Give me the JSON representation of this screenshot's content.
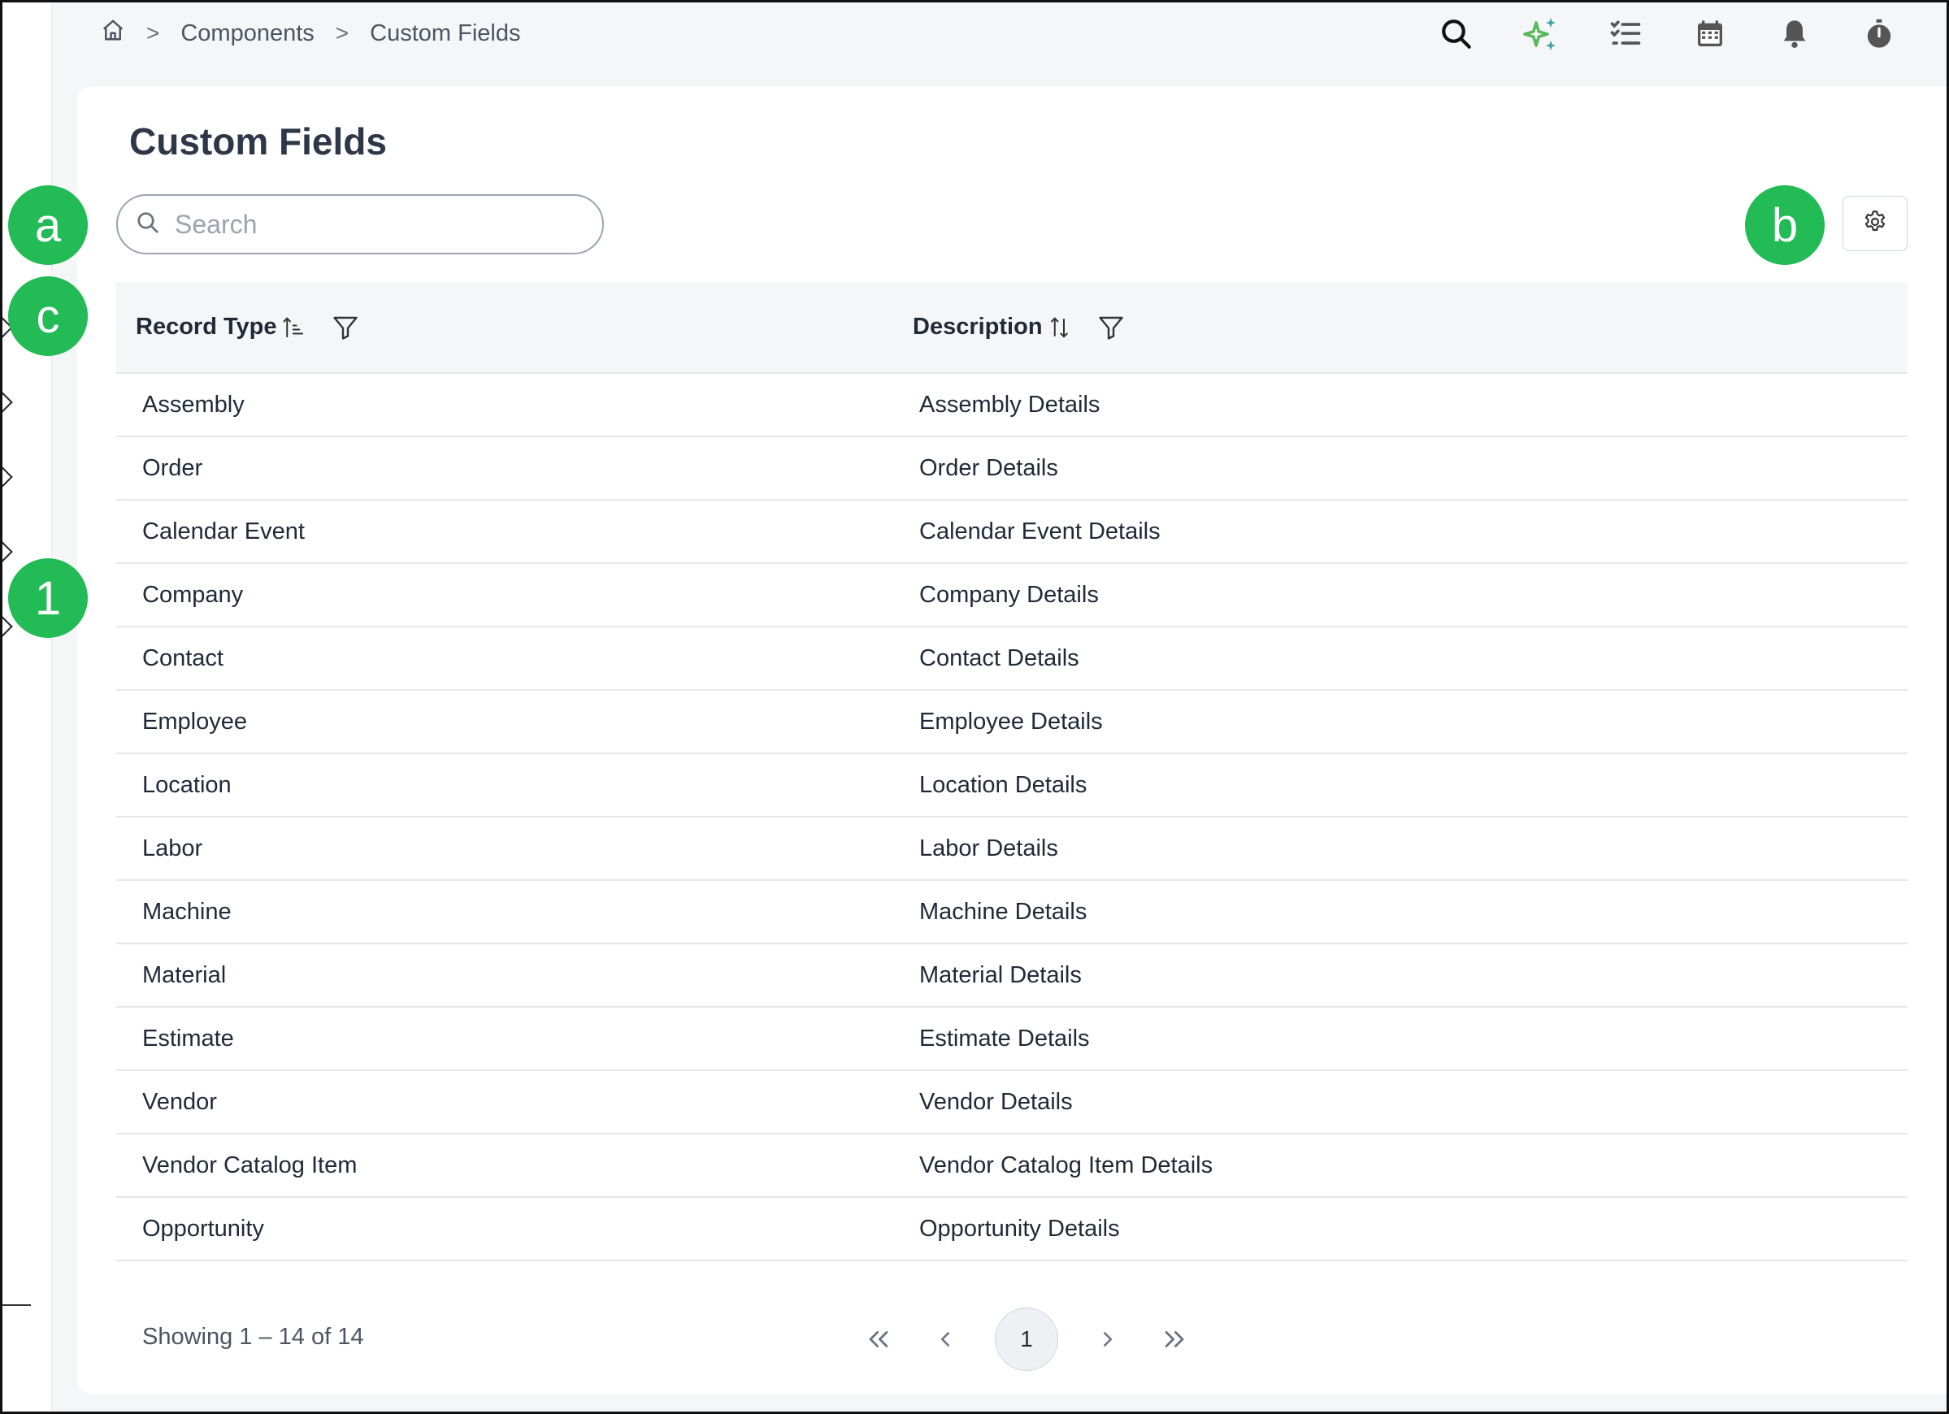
{
  "breadcrumb": {
    "home_icon": "home-icon",
    "items": [
      "Components",
      "Custom Fields"
    ],
    "separator": ">"
  },
  "top_icons": [
    "search-icon",
    "sparkle-icon",
    "checklist-icon",
    "calendar-icon",
    "bell-icon",
    "timer-icon"
  ],
  "page": {
    "title": "Custom Fields"
  },
  "search": {
    "placeholder": "Search",
    "value": ""
  },
  "table": {
    "columns": [
      {
        "label": "Record Type",
        "sort_icon": "sort-ascending-icon",
        "filter_icon": "filter-icon"
      },
      {
        "label": "Description",
        "sort_icon": "sort-icon",
        "filter_icon": "filter-icon"
      }
    ],
    "rows": [
      {
        "record_type": "Assembly",
        "description": "Assembly Details"
      },
      {
        "record_type": "Order",
        "description": "Order Details"
      },
      {
        "record_type": "Calendar Event",
        "description": "Calendar Event Details"
      },
      {
        "record_type": "Company",
        "description": "Company Details"
      },
      {
        "record_type": "Contact",
        "description": "Contact Details"
      },
      {
        "record_type": "Employee",
        "description": "Employee Details"
      },
      {
        "record_type": "Location",
        "description": "Location Details"
      },
      {
        "record_type": "Labor",
        "description": "Labor Details"
      },
      {
        "record_type": "Machine",
        "description": "Machine Details"
      },
      {
        "record_type": "Material",
        "description": "Material Details"
      },
      {
        "record_type": "Estimate",
        "description": "Estimate Details"
      },
      {
        "record_type": "Vendor",
        "description": "Vendor Details"
      },
      {
        "record_type": "Vendor Catalog Item",
        "description": "Vendor Catalog Item Details"
      },
      {
        "record_type": "Opportunity",
        "description": "Opportunity Details"
      }
    ]
  },
  "footer": {
    "showing": "Showing 1 – 14 of 14",
    "current_page": "1"
  },
  "callouts": {
    "a": "a",
    "b": "b",
    "c": "c",
    "one": "1"
  },
  "colors": {
    "callout": "#22bb55",
    "sparkle": "#5cb85c"
  }
}
